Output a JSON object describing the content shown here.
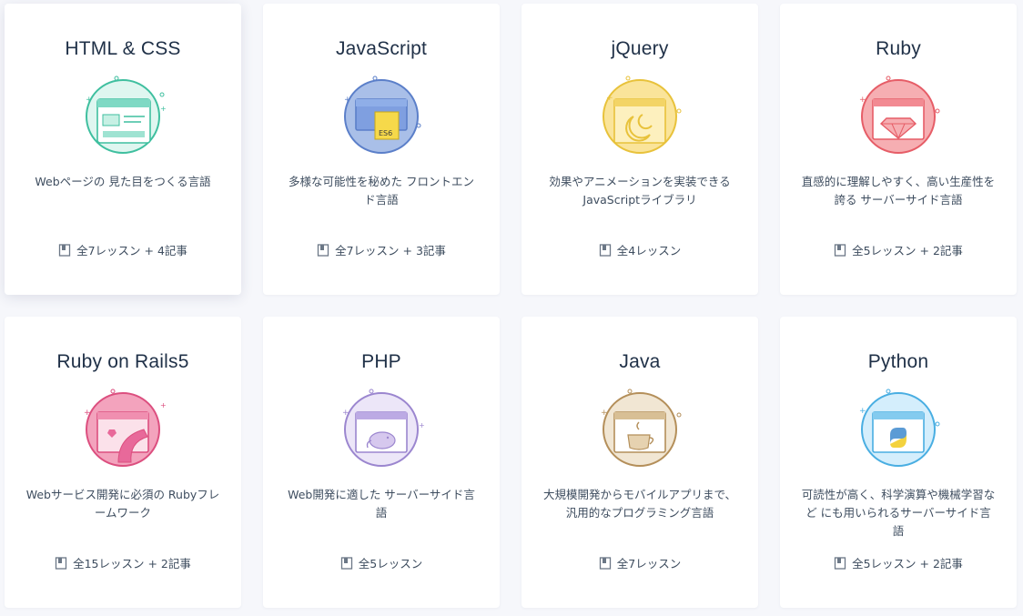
{
  "courses": [
    {
      "title": "HTML & CSS",
      "description": "Webページの 見た目をつくる言語",
      "meta": "全7レッスン + 4記事",
      "icon": "html-css-icon",
      "color": "#7fd9c4",
      "stroke": "#3fbf9f"
    },
    {
      "title": "JavaScript",
      "description": "多様な可能性を秘めた フロントエンド言語",
      "meta": "全7レッスン + 3記事",
      "icon": "javascript-icon",
      "color": "#a9bfe8",
      "stroke": "#5b7fc9"
    },
    {
      "title": "jQuery",
      "description": "効果やアニメーションを実装できる JavaScriptライブラリ",
      "meta": "全4レッスン",
      "icon": "jquery-icon",
      "color": "#fae49a",
      "stroke": "#e8c23b"
    },
    {
      "title": "Ruby",
      "description": "直感的に理解しやすく、高い生産性を 誇る サーバーサイド言語",
      "meta": "全5レッスン + 2記事",
      "icon": "ruby-icon",
      "color": "#f6aeb2",
      "stroke": "#e65d67"
    },
    {
      "title": "Ruby on Rails5",
      "description": "Webサービス開発に必須の Rubyフレームワーク",
      "meta": "全15レッスン + 2記事",
      "icon": "rails-icon",
      "color": "#f3a3bd",
      "stroke": "#dc4f7f"
    },
    {
      "title": "PHP",
      "description": "Web開発に適した サーバーサイド言語",
      "meta": "全5レッスン",
      "icon": "php-icon",
      "color": "#d6c8ee",
      "stroke": "#9b86cf"
    },
    {
      "title": "Java",
      "description": "大規模開発からモバイルアプリまで、 汎用的なプログラミング言語",
      "meta": "全7レッスン",
      "icon": "java-icon",
      "color": "#e6d2b0",
      "stroke": "#b48f5a"
    },
    {
      "title": "Python",
      "description": "可読性が高く、科学演算や機械学習な ど にも用いられるサーバーサイド言語",
      "meta": "全5レッスン + 2記事",
      "icon": "python-icon",
      "color": "#b6e2fa",
      "stroke": "#49aee2"
    }
  ],
  "book_icon": "book-icon"
}
